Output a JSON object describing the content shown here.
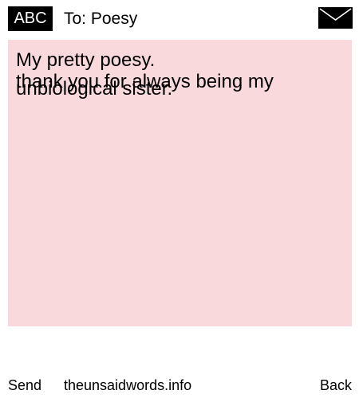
{
  "header": {
    "badge": "ABC",
    "recipient": "To: Poesy",
    "envelope_icon": "envelope-icon"
  },
  "message": {
    "background": "#f9d9dc",
    "lines": [
      "My pretty poesy.",
      "thank you for always being my",
      "unbiological sister."
    ]
  },
  "footer": {
    "send_label": "Send",
    "site_label": "theunsaidwords.info",
    "back_label": "Back"
  }
}
